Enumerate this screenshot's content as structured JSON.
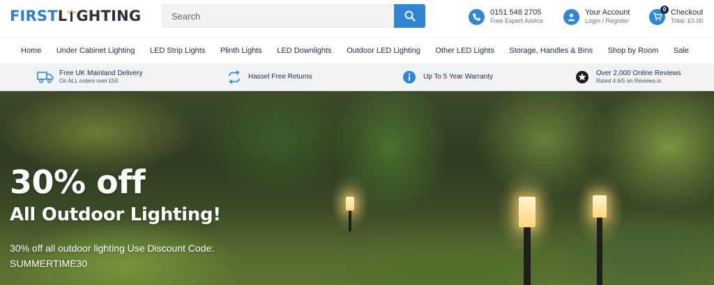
{
  "brand": {
    "logo_first": "FIRST",
    "logo_l": "L",
    "logo_rest": "GHTING"
  },
  "search": {
    "placeholder": "Search"
  },
  "header": {
    "phone": {
      "main": "0151 548 2705",
      "sub": "Free Expert Advice"
    },
    "account": {
      "main": "Your Account",
      "sub": "Login / Register"
    },
    "checkout": {
      "main": "Checkout",
      "sub": "Total: £0.00",
      "count": "0"
    }
  },
  "nav": {
    "items": [
      {
        "label": "Home"
      },
      {
        "label": "Under Cabinet Lighting"
      },
      {
        "label": "LED Strip Lights"
      },
      {
        "label": "Plinth Lights"
      },
      {
        "label": "LED Downlights"
      },
      {
        "label": "Outdoor LED Lighting"
      },
      {
        "label": "Other LED Lights"
      },
      {
        "label": "Storage, Handles & Bins"
      },
      {
        "label": "Shop by Room"
      },
      {
        "label": "Sale"
      }
    ]
  },
  "usp": {
    "delivery": {
      "main": "Free UK Mainland Delivery",
      "sub": "On ALL orders over £50",
      "icon": "truck-icon"
    },
    "returns": {
      "main": "Hassel Free Returns",
      "icon": "returns-icon"
    },
    "warranty": {
      "main": "Up To 5 Year Warranty",
      "icon": "info-icon"
    },
    "reviews": {
      "main": "Over 2,000 Online Reviews",
      "sub": "Rated 4.6/5 on Reviews.io",
      "icon": "star-icon"
    }
  },
  "hero": {
    "headline": "30% off",
    "subheadline": "All Outdoor Lighting!",
    "body": "30% off all outdoor lighting Use Discount Code: SUMMERTIME30"
  },
  "colors": {
    "accent": "#2f86d2",
    "brand_blue": "#2a7fc6",
    "text_dark": "#1f2a44",
    "usp_bar": "#f1f2f4"
  }
}
